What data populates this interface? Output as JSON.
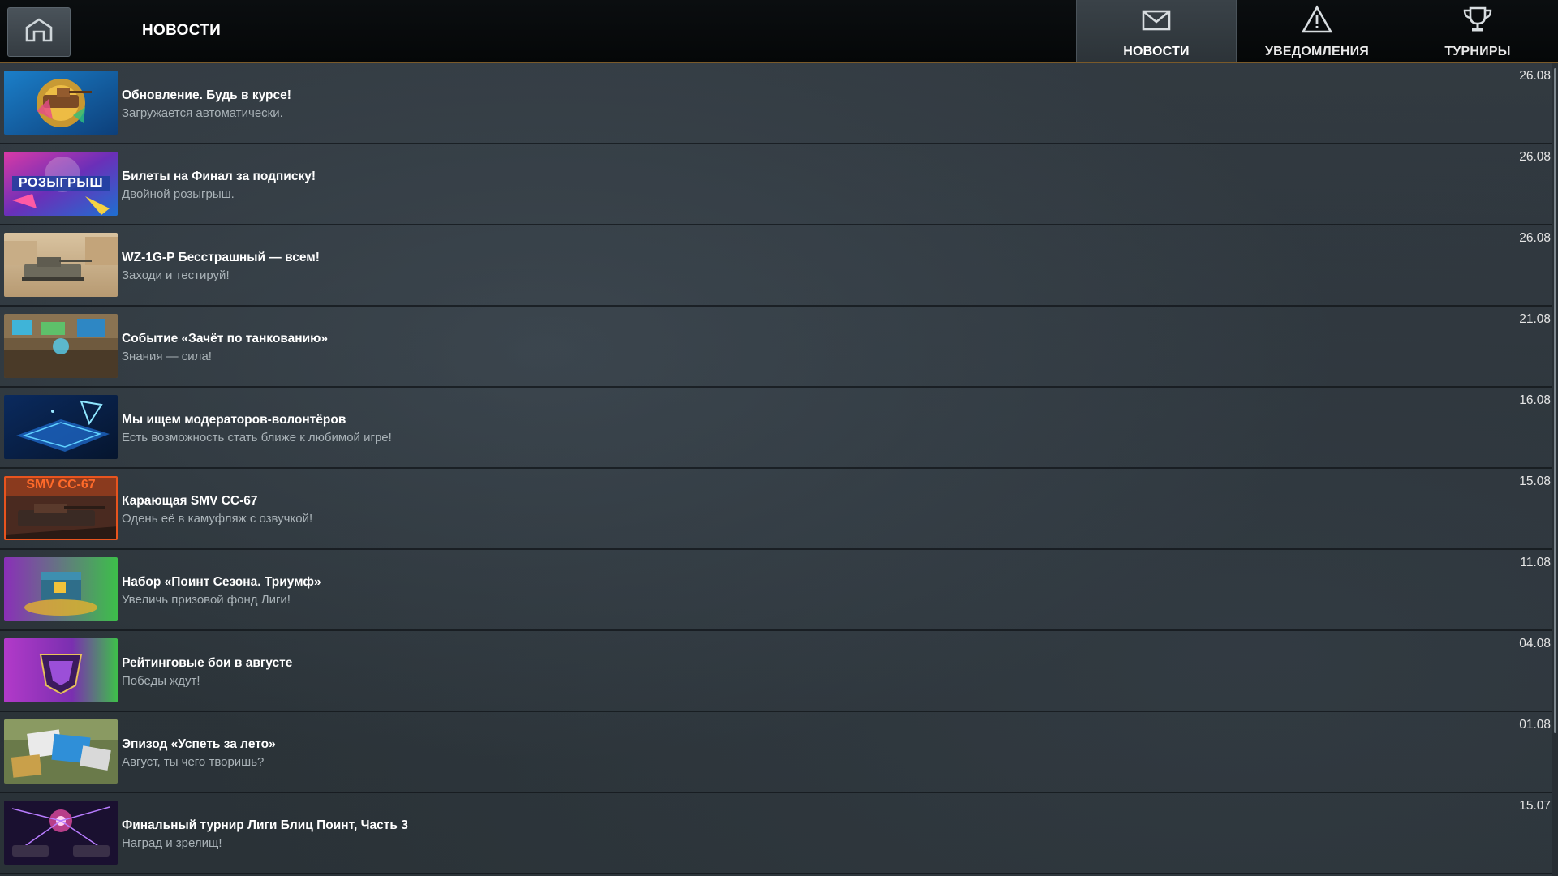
{
  "header": {
    "home_icon": "home-icon",
    "title": "НОВОСТИ",
    "tabs": [
      {
        "label": "НОВОСТИ",
        "icon": "envelope-icon",
        "active": true
      },
      {
        "label": "УВЕДОМЛЕНИЯ",
        "icon": "warning-icon",
        "active": false
      },
      {
        "label": "ТУРНИРЫ",
        "icon": "trophy-icon",
        "active": false
      }
    ]
  },
  "news": [
    {
      "title": "Обновление. Будь в курсе!",
      "subtitle": "Загружается автоматически.",
      "date": "26.08"
    },
    {
      "title": "Билеты на Финал за подписку!",
      "subtitle": "Двойной розыгрыш.",
      "date": "26.08",
      "thumb_text": "РОЗЫГРЫШ"
    },
    {
      "title": "WZ-1G-P Бесстрашный — всем!",
      "subtitle": "Заходи и тестируй!",
      "date": "26.08"
    },
    {
      "title": "Событие «Зачёт по танкованию»",
      "subtitle": "Знания — сила!",
      "date": "21.08"
    },
    {
      "title": "Мы ищем модераторов-волонтёров",
      "subtitle": "Есть возможность стать ближе к любимой игре!",
      "date": "16.08"
    },
    {
      "title": "Карающая SMV CC-67",
      "subtitle": "Одень её в камуфляж с озвучкой!",
      "date": "15.08",
      "thumb_text": "SMV CC-67"
    },
    {
      "title": "Набор «Поинт Сезона. Триумф»",
      "subtitle": "Увеличь призовой фонд Лиги!",
      "date": "11.08"
    },
    {
      "title": "Рейтинговые бои в августе",
      "subtitle": "Победы ждут!",
      "date": "04.08"
    },
    {
      "title": "Эпизод «Успеть за лето»",
      "subtitle": "Август, ты чего творишь?",
      "date": "01.08"
    },
    {
      "title": "Финальный турнир Лиги Блиц Поинт, Часть 3",
      "subtitle": "Наград и зрелищ!",
      "date": "15.07"
    }
  ]
}
